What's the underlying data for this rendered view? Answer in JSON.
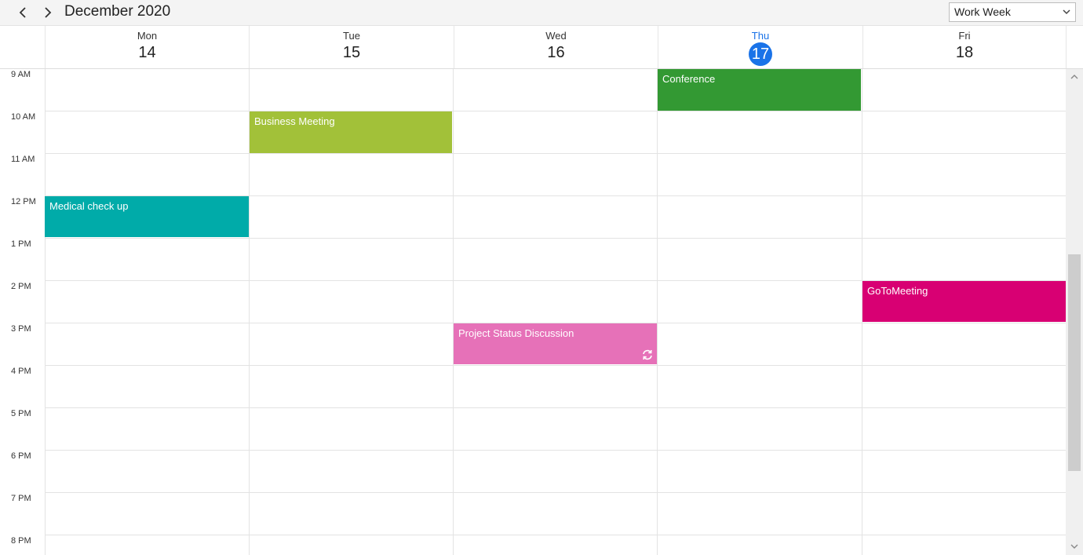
{
  "toolbar": {
    "prev_icon": "chevron-left-icon",
    "next_icon": "chevron-right-icon",
    "month_label": "December 2020",
    "view_select_value": "Work Week"
  },
  "days": [
    {
      "name": "Mon",
      "date": "14"
    },
    {
      "name": "Tue",
      "date": "15"
    },
    {
      "name": "Wed",
      "date": "16"
    },
    {
      "name": "Thu",
      "date": "17"
    },
    {
      "name": "Fri",
      "date": "18"
    }
  ],
  "today": "Thu 17",
  "time_slots": [
    "9 AM",
    "10 AM",
    "11 AM",
    "12 PM",
    "1 PM",
    "2 PM",
    "3 PM",
    "4 PM",
    "5 PM",
    "6 PM",
    "7 PM",
    "8 PM"
  ],
  "events": [
    {
      "title": "Conference",
      "day": "Thu",
      "start": "9 AM",
      "end": "10 AM",
      "color": "#339933"
    },
    {
      "title": "Business Meeting",
      "day": "Tue",
      "start": "10 AM",
      "end": "11 AM",
      "color": "#a2c139"
    },
    {
      "title": "Medical check up",
      "day": "Mon",
      "start": "12 PM",
      "end": "1 PM",
      "color": "#00aba9"
    },
    {
      "title": "GoToMeeting",
      "day": "Fri",
      "start": "2 PM",
      "end": "3 PM",
      "color": "#d80073"
    },
    {
      "title": "Project Status Discussion",
      "day": "Wed",
      "start": "3 PM",
      "end": "4 PM",
      "color": "#e671b8",
      "recurring": true,
      "icon": "recurrence-icon"
    }
  ],
  "colors": {
    "accent": "#1a73e8",
    "grid_line": "#e3e3e3"
  }
}
